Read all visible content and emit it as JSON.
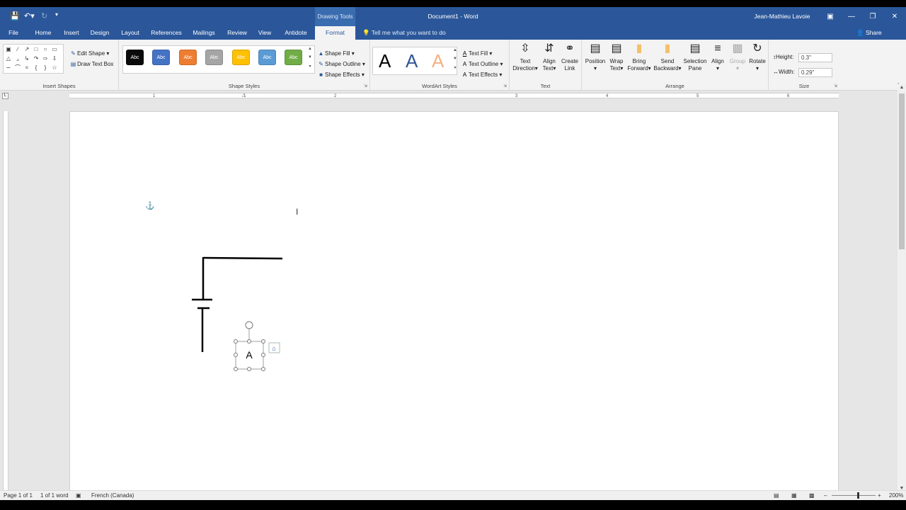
{
  "titlebar": {
    "context_tab": "Drawing Tools",
    "document_title": "Document1  -  Word",
    "user": "Jean-Mathieu Lavoie",
    "save_icon": "save-icon",
    "undo_icon": "undo-icon",
    "redo_icon": "redo-icon"
  },
  "tabs": [
    "File",
    "Home",
    "Insert",
    "Design",
    "Layout",
    "References",
    "Mailings",
    "Review",
    "View",
    "Antidote",
    "Format"
  ],
  "active_tab": "Format",
  "tellme": "Tell me what you want to do",
  "share": "Share",
  "ribbon": {
    "insert_shapes": {
      "label": "Insert Shapes",
      "edit_shape": "Edit Shape",
      "draw_text_box": "Draw Text Box"
    },
    "shape_styles": {
      "label": "Shape Styles",
      "tile_text": "Abc",
      "tiles": [
        "#0a0a0a",
        "#4472c4",
        "#ed7d31",
        "#a5a5a5",
        "#ffc000",
        "#5b9bd5",
        "#70ad47"
      ],
      "shape_fill": "Shape Fill",
      "shape_outline": "Shape Outline",
      "shape_effects": "Shape Effects"
    },
    "wordart_styles": {
      "label": "WordArt Styles",
      "letter": "A",
      "text_fill": "Text Fill",
      "text_outline": "Text Outline",
      "text_effects": "Text Effects"
    },
    "text": {
      "label": "Text",
      "text_direction_1": "Text",
      "text_direction_2": "Direction",
      "align_text_1": "Align",
      "align_text_2": "Text",
      "create_link_1": "Create",
      "create_link_2": "Link"
    },
    "arrange": {
      "label": "Arrange",
      "position": "Position",
      "wrap_text_1": "Wrap",
      "wrap_text_2": "Text",
      "bring_forward_1": "Bring",
      "bring_forward_2": "Forward",
      "send_backward_1": "Send",
      "send_backward_2": "Backward",
      "selection_pane_1": "Selection",
      "selection_pane_2": "Pane",
      "align": "Align",
      "group": "Group",
      "rotate": "Rotate"
    },
    "size": {
      "label": "Size",
      "height_label": "Height:",
      "height_value": "0.3\"",
      "width_label": "Width:",
      "width_value": "0.29\""
    }
  },
  "ruler_numbers": [
    "1",
    "1",
    "2",
    "3",
    "4",
    "5",
    "6"
  ],
  "document": {
    "textbox_letter": "A"
  },
  "status": {
    "page": "Page 1 of 1",
    "words": "1 of 1 word",
    "language": "French (Canada)",
    "zoom": "200%"
  }
}
